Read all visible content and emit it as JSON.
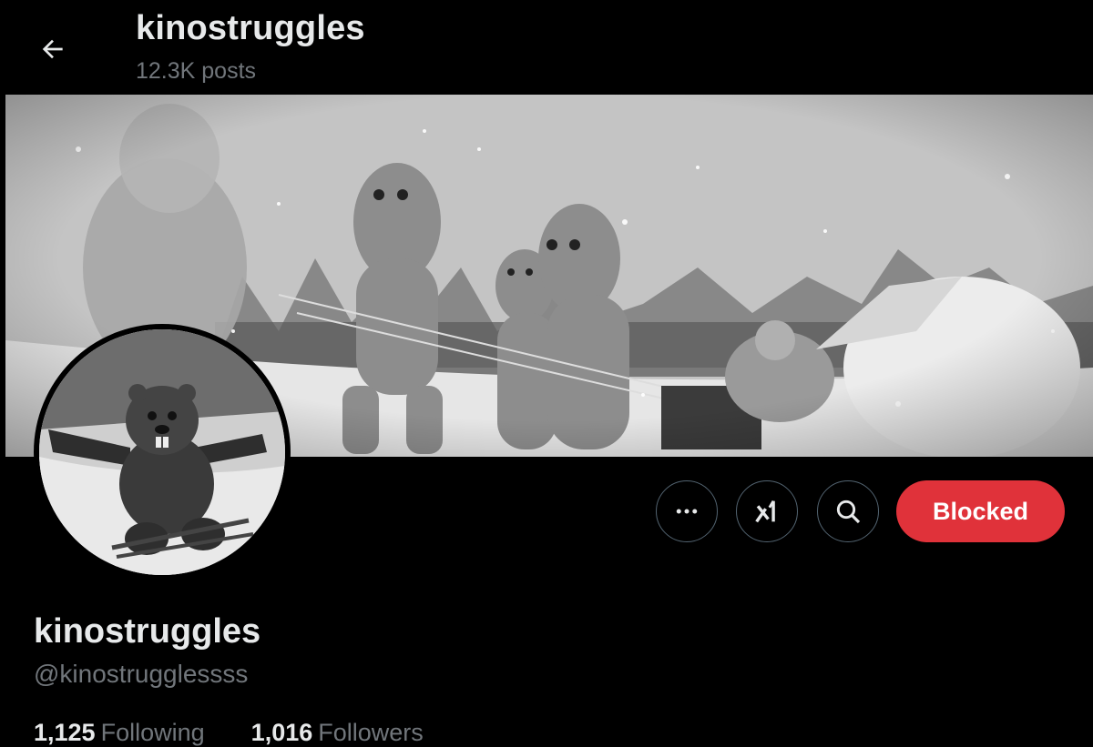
{
  "header": {
    "title": "kinostruggles",
    "posts_count": "12.3K posts"
  },
  "icons": {
    "back": "arrow-left-icon",
    "more": "more-horizontal-icon",
    "grok": "grok-icon",
    "search": "search-icon"
  },
  "actions": {
    "blocked_label": "Blocked"
  },
  "profile": {
    "display_name": "kinostruggles",
    "handle": "@kinostrugglessss",
    "following_count": "1,125",
    "following_label": "Following",
    "followers_count": "1,016",
    "followers_label": "Followers"
  },
  "colors": {
    "background": "#000000",
    "text_primary": "#e7e9ea",
    "text_secondary": "#71767b",
    "blocked_button": "#e0323a",
    "border": "#536471"
  }
}
